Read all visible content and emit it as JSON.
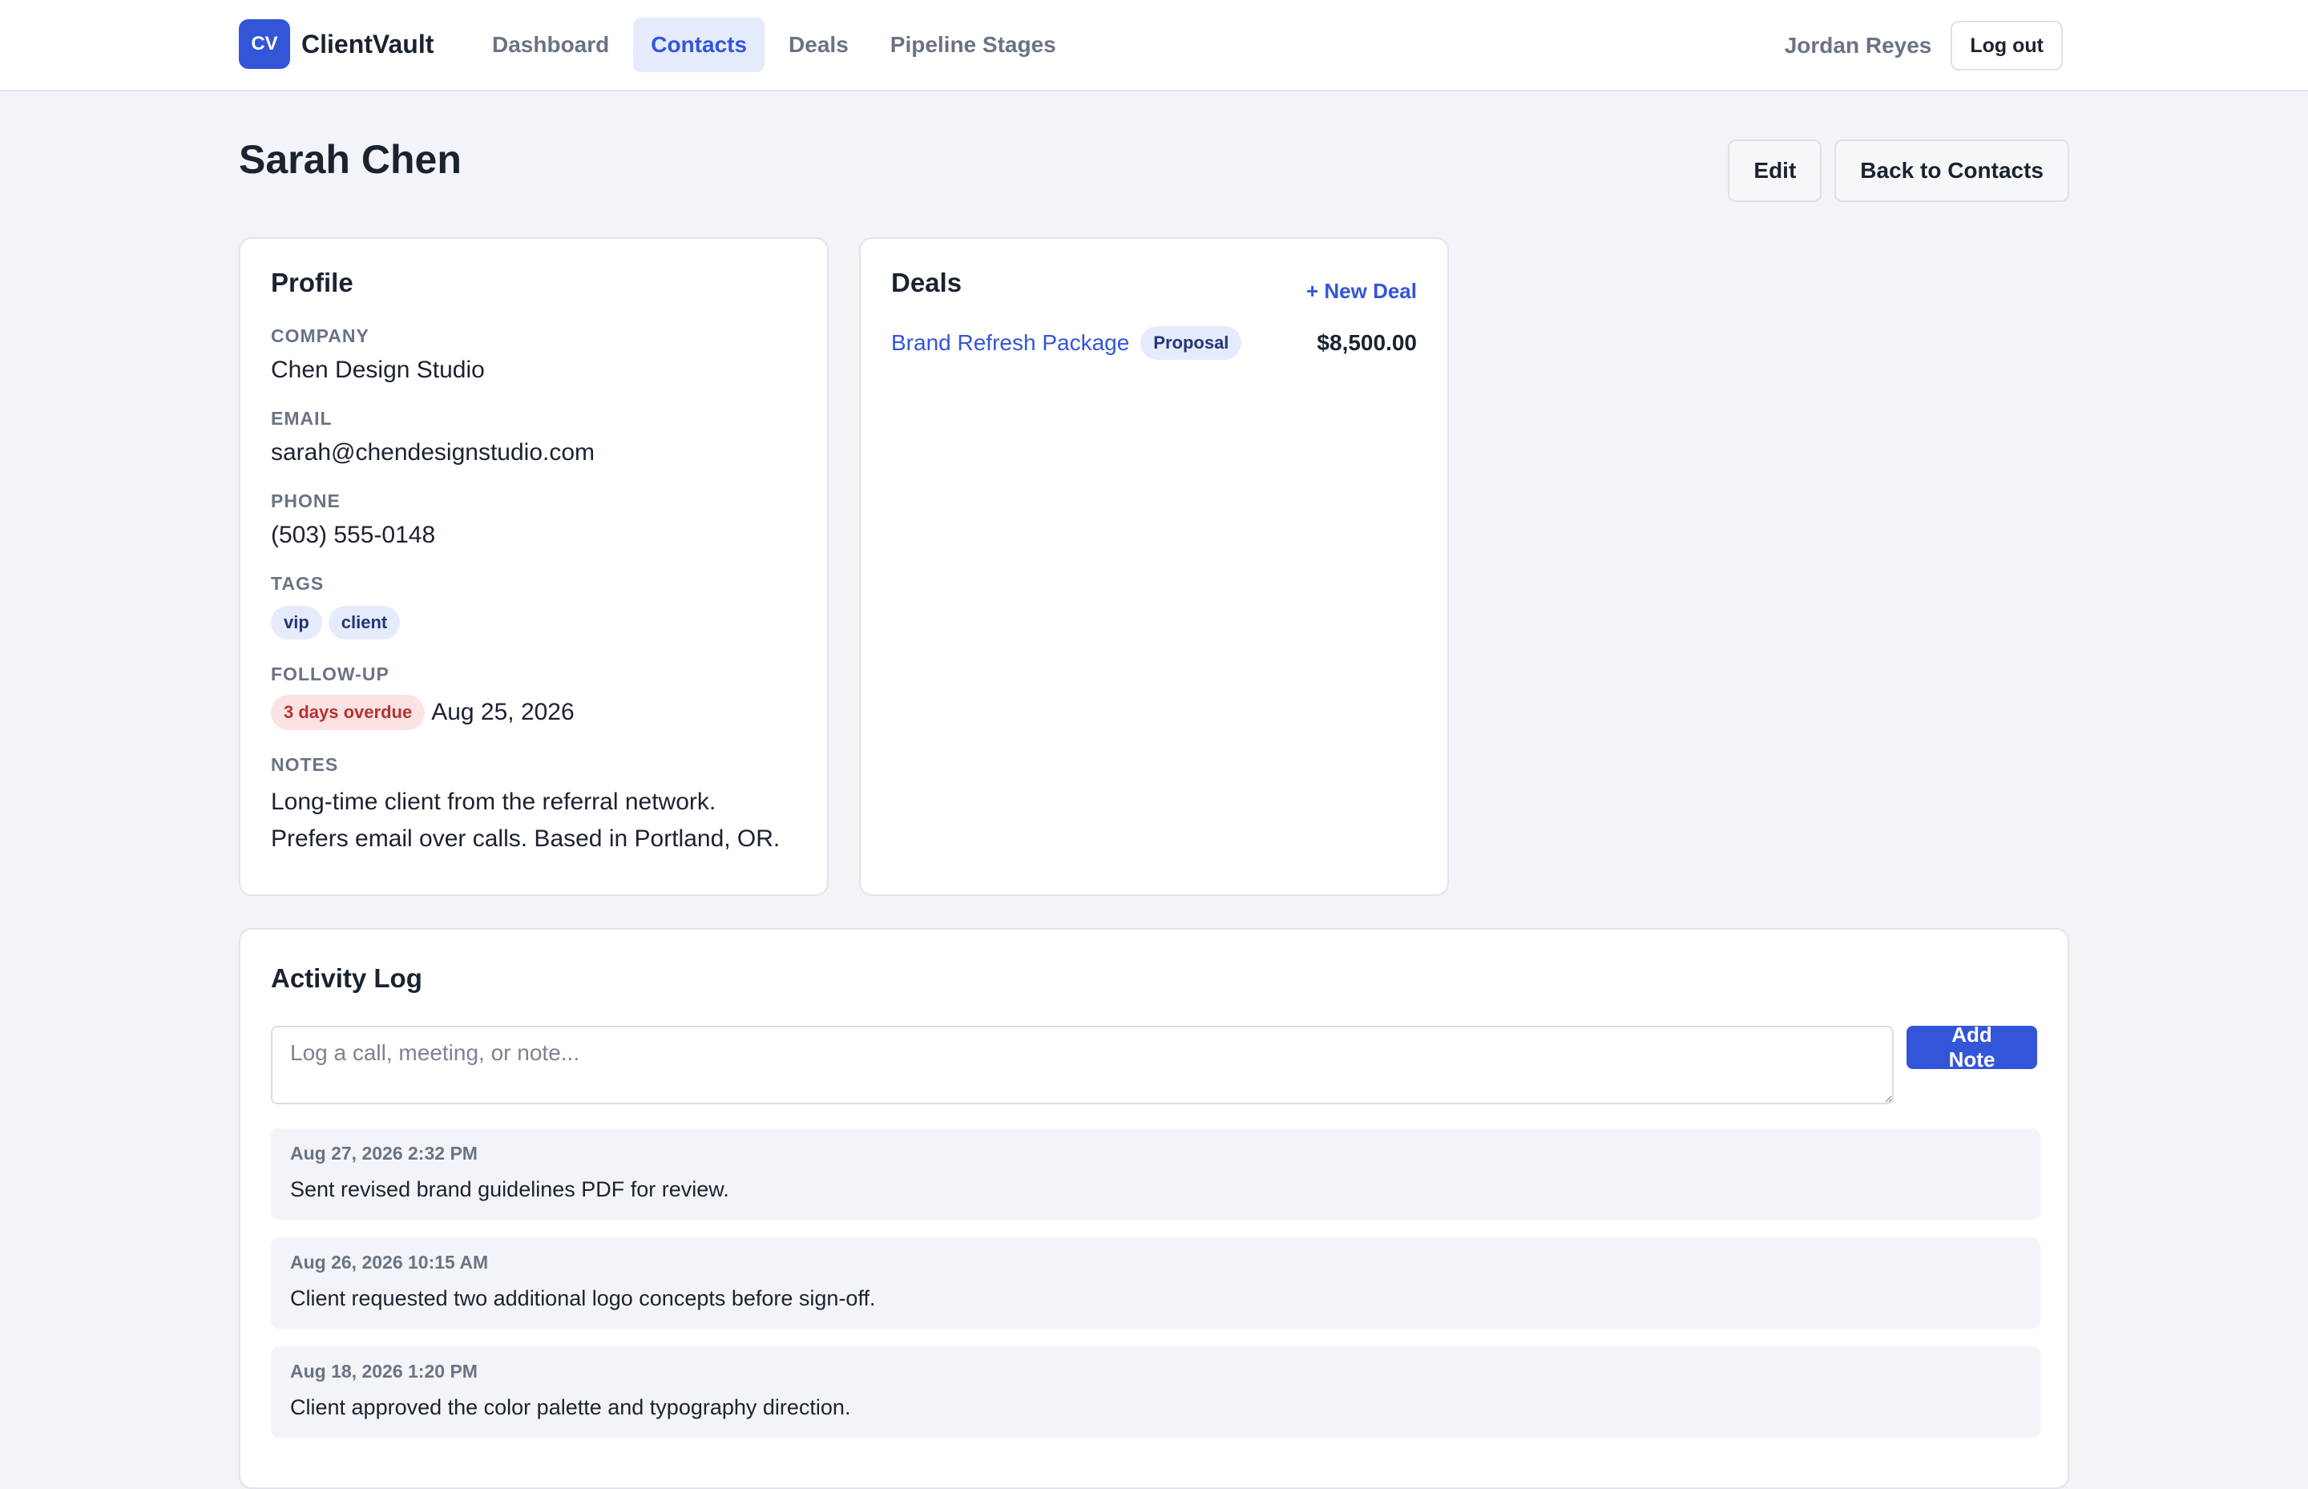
{
  "brand": {
    "logo": "CV",
    "name": "ClientVault"
  },
  "nav": {
    "items": [
      {
        "label": "Dashboard",
        "active": false
      },
      {
        "label": "Contacts",
        "active": true
      },
      {
        "label": "Deals",
        "active": false
      },
      {
        "label": "Pipeline Stages",
        "active": false
      }
    ]
  },
  "user": {
    "name": "Jordan Reyes",
    "logout_label": "Log out"
  },
  "page": {
    "title": "Sarah Chen",
    "edit_label": "Edit",
    "back_label": "Back to Contacts"
  },
  "profile": {
    "title": "Profile",
    "company_label": "COMPANY",
    "company": "Chen Design Studio",
    "email_label": "EMAIL",
    "email": "sarah@chendesignstudio.com",
    "phone_label": "PHONE",
    "phone": "(503) 555-0148",
    "tags_label": "TAGS",
    "tags": [
      "vip",
      "client"
    ],
    "followup_label": "FOLLOW-UP",
    "overdue_badge": "3 days overdue",
    "followup_date": "Aug 25, 2026",
    "notes_label": "NOTES",
    "notes": "Long-time client from the referral network. Prefers email over calls. Based in Portland, OR."
  },
  "deals": {
    "title": "Deals",
    "new_deal_label": "+ New Deal",
    "items": [
      {
        "name": "Brand Refresh Package",
        "stage": "Proposal",
        "amount": "$8,500.00"
      }
    ]
  },
  "activity": {
    "title": "Activity Log",
    "placeholder": "Log a call, meeting, or note...",
    "add_note_label": "Add Note",
    "entries": [
      {
        "time": "Aug 27, 2026 2:32 PM",
        "text": "Sent revised brand guidelines PDF for review."
      },
      {
        "time": "Aug 26, 2026 10:15 AM",
        "text": "Client requested two additional logo concepts before sign-off."
      },
      {
        "time": "Aug 18, 2026 1:20 PM",
        "text": "Client approved the color palette and typography direction."
      }
    ]
  },
  "colors": {
    "accent": "#3355d8",
    "danger": "#b83232",
    "background": "#f3f4f7"
  }
}
